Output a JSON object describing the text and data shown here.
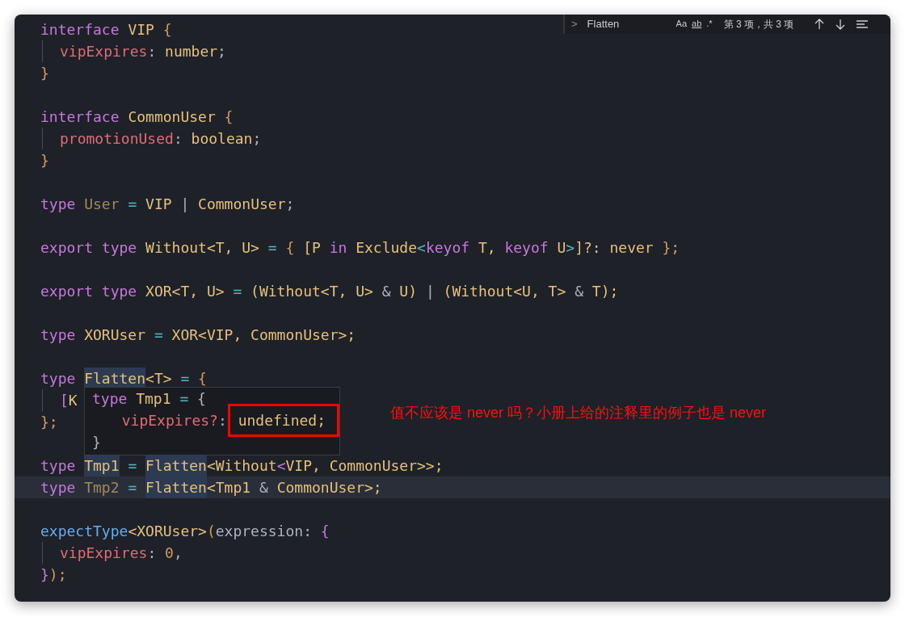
{
  "find_widget": {
    "toggle": ">",
    "query": "Flatten",
    "options": [
      "Aa",
      "ab",
      ".*"
    ],
    "result": "第 3 项，共 3 项"
  },
  "editor": {
    "lines": [
      {
        "current": false,
        "tokens": [
          {
            "text": "interface ",
            "kind": "keyword"
          },
          {
            "text": "VIP ",
            "kind": "type"
          },
          {
            "text": "{",
            "kind": "brace"
          }
        ]
      },
      {
        "current": false,
        "indent": true,
        "tokens": [
          {
            "text": "vipExpires",
            "kind": "property"
          },
          {
            "text": ": ",
            "kind": "punct"
          },
          {
            "text": "number",
            "kind": "type"
          },
          {
            "text": ";",
            "kind": "punct"
          }
        ]
      },
      {
        "current": false,
        "tokens": [
          {
            "text": "}",
            "kind": "brace"
          }
        ]
      },
      {
        "current": false
      },
      {
        "current": false,
        "tokens": [
          {
            "text": "interface ",
            "kind": "keyword"
          },
          {
            "text": "CommonUser ",
            "kind": "type"
          },
          {
            "text": "{",
            "kind": "brace"
          }
        ]
      },
      {
        "current": false,
        "indent": true,
        "tokens": [
          {
            "text": "promotionUsed",
            "kind": "property"
          },
          {
            "text": ": ",
            "kind": "punct"
          },
          {
            "text": "boolean",
            "kind": "type"
          },
          {
            "text": ";",
            "kind": "punct"
          }
        ]
      },
      {
        "current": false,
        "tokens": [
          {
            "text": "}",
            "kind": "brace"
          }
        ]
      },
      {
        "current": false
      },
      {
        "current": false,
        "tokens": [
          {
            "text": "type ",
            "kind": "keyword"
          },
          {
            "text": "User ",
            "kind": "unused"
          },
          {
            "text": "= ",
            "kind": "operator"
          },
          {
            "text": "VIP ",
            "kind": "type"
          },
          {
            "text": "| ",
            "kind": "punct"
          },
          {
            "text": "CommonUser",
            "kind": "type"
          },
          {
            "text": ";",
            "kind": "punct"
          }
        ]
      },
      {
        "current": false
      },
      {
        "current": false,
        "tokens": [
          {
            "text": "export type ",
            "kind": "keyword"
          },
          {
            "text": "Without<T, U> ",
            "kind": "type"
          },
          {
            "text": "= ",
            "kind": "operator"
          },
          {
            "text": "{ ",
            "kind": "brace"
          },
          {
            "text": "[P ",
            "kind": "type"
          },
          {
            "text": "in ",
            "kind": "keyword"
          },
          {
            "text": "Exclude",
            "kind": "type"
          },
          {
            "text": "<",
            "kind": "operator"
          },
          {
            "text": "keyof ",
            "kind": "keyword"
          },
          {
            "text": "T, ",
            "kind": "type"
          },
          {
            "text": "keyof ",
            "kind": "keyword"
          },
          {
            "text": "U",
            "kind": "type"
          },
          {
            "text": ">",
            "kind": "operator"
          },
          {
            "text": "]?: never ",
            "kind": "type"
          },
          {
            "text": "};",
            "kind": "brace"
          }
        ]
      },
      {
        "current": false
      },
      {
        "current": false,
        "tokens": [
          {
            "text": "export type ",
            "kind": "keyword"
          },
          {
            "text": "XOR<T, U> ",
            "kind": "type"
          },
          {
            "text": "= ",
            "kind": "operator"
          },
          {
            "text": "(Without<T, U> ",
            "kind": "type"
          },
          {
            "text": "& ",
            "kind": "punct"
          },
          {
            "text": "U) ",
            "kind": "type"
          },
          {
            "text": "| ",
            "kind": "punct"
          },
          {
            "text": "(Without<U, T> ",
            "kind": "type"
          },
          {
            "text": "& ",
            "kind": "punct"
          },
          {
            "text": "T);",
            "kind": "type"
          }
        ]
      },
      {
        "current": false
      },
      {
        "current": false,
        "tokens": [
          {
            "text": "type ",
            "kind": "keyword"
          },
          {
            "text": "XORUser ",
            "kind": "type"
          },
          {
            "text": "= ",
            "kind": "operator"
          },
          {
            "text": "XOR<VIP, CommonUser>;",
            "kind": "type"
          }
        ]
      },
      {
        "current": false
      },
      {
        "current": false,
        "tokens": [
          {
            "text": "type ",
            "kind": "keyword"
          },
          {
            "text": "Flatten",
            "kind": "type",
            "highlight": true
          },
          {
            "text": "<T> ",
            "kind": "type"
          },
          {
            "text": "= ",
            "kind": "operator"
          },
          {
            "text": "{",
            "kind": "brace"
          }
        ]
      },
      {
        "current": false,
        "indent": true,
        "tokens": [
          {
            "text": "[",
            "kind": "bracket"
          },
          {
            "text": "K",
            "kind": "type"
          }
        ]
      },
      {
        "current": false,
        "tokens": [
          {
            "text": "};",
            "kind": "brace"
          }
        ]
      },
      {
        "current": false
      },
      {
        "current": false,
        "tokens": [
          {
            "text": "type ",
            "kind": "keyword"
          },
          {
            "text": "Tmp1",
            "kind": "type",
            "highlight": true
          },
          {
            "text": " = ",
            "kind": "operator"
          },
          {
            "text": "Flatten",
            "kind": "type",
            "highlight": true
          },
          {
            "text": "<Without",
            "kind": "type"
          },
          {
            "text": "<",
            "kind": "keyword"
          },
          {
            "text": "VIP, CommonUser>>;",
            "kind": "type"
          }
        ]
      },
      {
        "current": true,
        "tokens": [
          {
            "text": "type ",
            "kind": "keyword"
          },
          {
            "text": "Tmp2 ",
            "kind": "unused"
          },
          {
            "text": "= ",
            "kind": "operator"
          },
          {
            "text": "Flatten",
            "kind": "type",
            "highlight": true
          },
          {
            "text": "<Tmp1 ",
            "kind": "type"
          },
          {
            "text": "& ",
            "kind": "punct"
          },
          {
            "text": "CommonUser>;",
            "kind": "type"
          }
        ]
      },
      {
        "current": false
      },
      {
        "current": false,
        "tokens": [
          {
            "text": "expectType",
            "kind": "function"
          },
          {
            "text": "<XORUser>",
            "kind": "type"
          },
          {
            "text": "(",
            "kind": "brace"
          },
          {
            "text": "expression: ",
            "kind": "punct"
          },
          {
            "text": "{",
            "kind": "bracket"
          }
        ]
      },
      {
        "current": false,
        "indent": true,
        "tokens": [
          {
            "text": "vipExpires",
            "kind": "property"
          },
          {
            "text": ": ",
            "kind": "punct"
          },
          {
            "text": "0",
            "kind": "brace"
          },
          {
            "text": ",",
            "kind": "punct"
          }
        ]
      },
      {
        "current": false,
        "tokens": [
          {
            "text": "}",
            "kind": "bracket"
          },
          {
            "text": ");",
            "kind": "brace"
          }
        ]
      }
    ]
  },
  "hover": {
    "lines": [
      {
        "tokens": [
          {
            "text": "type ",
            "kind": "keyword"
          },
          {
            "text": "Tmp1 ",
            "kind": "type"
          },
          {
            "text": "= ",
            "kind": "operator"
          },
          {
            "text": "{",
            "kind": "punct"
          }
        ]
      },
      {
        "indent": true,
        "tokens": [
          {
            "text": "vipExpires?",
            "kind": "property"
          },
          {
            "text": ": ",
            "kind": "punct"
          },
          {
            "text": "undefined;",
            "kind": "type",
            "marked": true
          }
        ]
      },
      {
        "tokens": [
          {
            "text": "}",
            "kind": "punct"
          }
        ]
      }
    ]
  },
  "annotation": "值不应该是 never 吗？小册上给的注释里的例子也是 never"
}
